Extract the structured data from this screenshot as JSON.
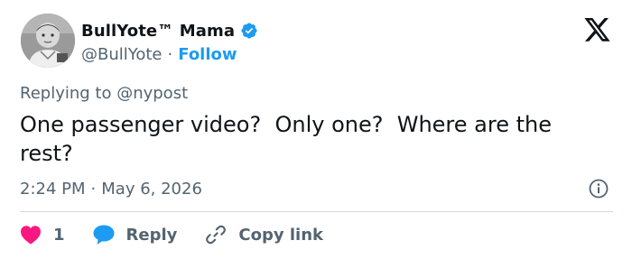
{
  "author": {
    "display_name": "BullYote™ Mama",
    "handle": "@BullYote",
    "separator": "·",
    "follow_label": "Follow"
  },
  "reply_context": "Replying to @nypost",
  "tweet": {
    "text": "One passenger video?  Only one?  Where are the rest?"
  },
  "meta": {
    "time": "2:24 PM",
    "separator": "·",
    "date": "May 6, 2026"
  },
  "actions": {
    "like_count": "1",
    "reply_label": "Reply",
    "copy_label": "Copy link"
  },
  "colors": {
    "accent": "#1d9bf0",
    "like": "#f91880",
    "text": "#0f1419",
    "muted": "#536471",
    "divider": "#cfd9de"
  }
}
